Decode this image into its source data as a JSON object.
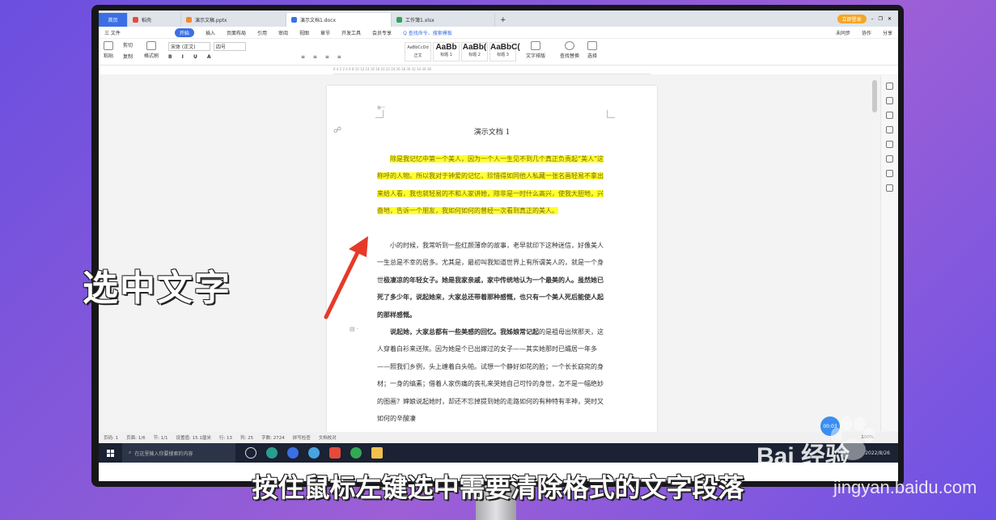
{
  "tabs": [
    {
      "label": "首页",
      "icon_color": "#3b6fe6"
    },
    {
      "label": "稻壳",
      "icon_color": "#e64a3b"
    },
    {
      "label": "演示文稿.pptx",
      "icon_color": "#f08a2c"
    },
    {
      "label": "演示文档1.docx",
      "icon_color": "#3b6fe6"
    },
    {
      "label": "工作簿1.xlsx",
      "icon_color": "#2fa35a"
    }
  ],
  "tabbar": {
    "new_tab": "+",
    "vip_label": "立即登录"
  },
  "menu": {
    "items": [
      "三 文件",
      "开始",
      "插入",
      "页面布局",
      "引用",
      "审阅",
      "视图",
      "章节",
      "开发工具",
      "会员专享"
    ],
    "search": "Q 查找命令、搜索模板",
    "right": [
      "未同步",
      "协作",
      "分享"
    ]
  },
  "ribbon": {
    "paste": "粘贴",
    "cut": "剪切",
    "copy": "复制",
    "format_painter": "格式刷",
    "font": "宋体 (正文)",
    "size": "四号",
    "styles": [
      {
        "sample": "AaBbCcDd",
        "name": "正文"
      },
      {
        "sample": "AaBb",
        "name": "标题 1"
      },
      {
        "sample": "AaBb(",
        "name": "标题 2"
      },
      {
        "sample": "AaBbC(",
        "name": "标题 3"
      }
    ],
    "text_tools": "文字排版",
    "find_replace": "查找替换",
    "select": "选择"
  },
  "ruler_marks": "6  4  2     2  4  6  8  10  12  14  16  18  20  22  24  26  28  30  32  34  36  38",
  "document": {
    "header_mark": "第一",
    "title": "演示文档 1",
    "highlighted_paragraph": "除是我记忆中第一个美人，因为一个人一生见不到几个真正负责起“美人”这称呼的人物。所以我对于钟爱的记忆，珍惜得如同他人私藏一张名画轻易不拿出来给人看，我也就轻易的不和人家讲她，除非是一时什么高兴，使我大胆地，兴奋地，告诉一个朋友，我如何如何的曾经一次看到真正的美人。",
    "paragraph2_normal": "小的时候，我常听到一些红颜薄命的故事，老早就印下这种迷信，好像美人一生总是不幸的居多。尤其是，最初叫我知道世界上有所谓美人的，就是一个身世",
    "paragraph2_bold": "极凄凉的年轻女子。她是我家亲戚，家中传统地认为一个最美的人。虽然她已死了多少年，说起她来，大家总还带着那种感慨，也只有一个美人死后能使人起的那样感慨。",
    "paragraph3_bold": "说起她，大家总都有一些美感的回忆。我姊娘常记起",
    "paragraph3_normal": "的是祖母出殡那天，这人穿着白衫来送殡。因为她是个已出嫁过的女子——其实她那时已孀居一年多——照我们乡例，头上缠着白头帕。试想一个静好如花的脸；一个长长窈窕的身材；一身的缟素；借着人家伤痛的丧礼来哭她自己可怜的身世，怎不是一幅绝妙的图画？婶娘说起她时，却还不忘掉提到她的走路如何的有种特有丰神，哭时又如何的辛酸凄"
  },
  "statusbar": {
    "items": [
      "页码: 1",
      "页面: 1/6",
      "节: 1/1",
      "设置值: 15.1厘米",
      "行: 13",
      "列: 25",
      "字数: 2724",
      "拼写检查",
      "文档校对"
    ],
    "zoom": "100%"
  },
  "taskbar": {
    "search_placeholder": "在这里输入你要搜索的内容",
    "time": "2022/8/26"
  },
  "timer": "00:03",
  "overlay_label": "选中文字",
  "subtitle": "按住鼠标左键选中需要清除格式的文字段落",
  "watermark": {
    "logo": "Bai 经验",
    "url": "jingyan.baidu.com"
  },
  "colors": {
    "accent": "#3b6fe6",
    "highlight": "#ffff2e",
    "arrow": "#e53a2a"
  }
}
